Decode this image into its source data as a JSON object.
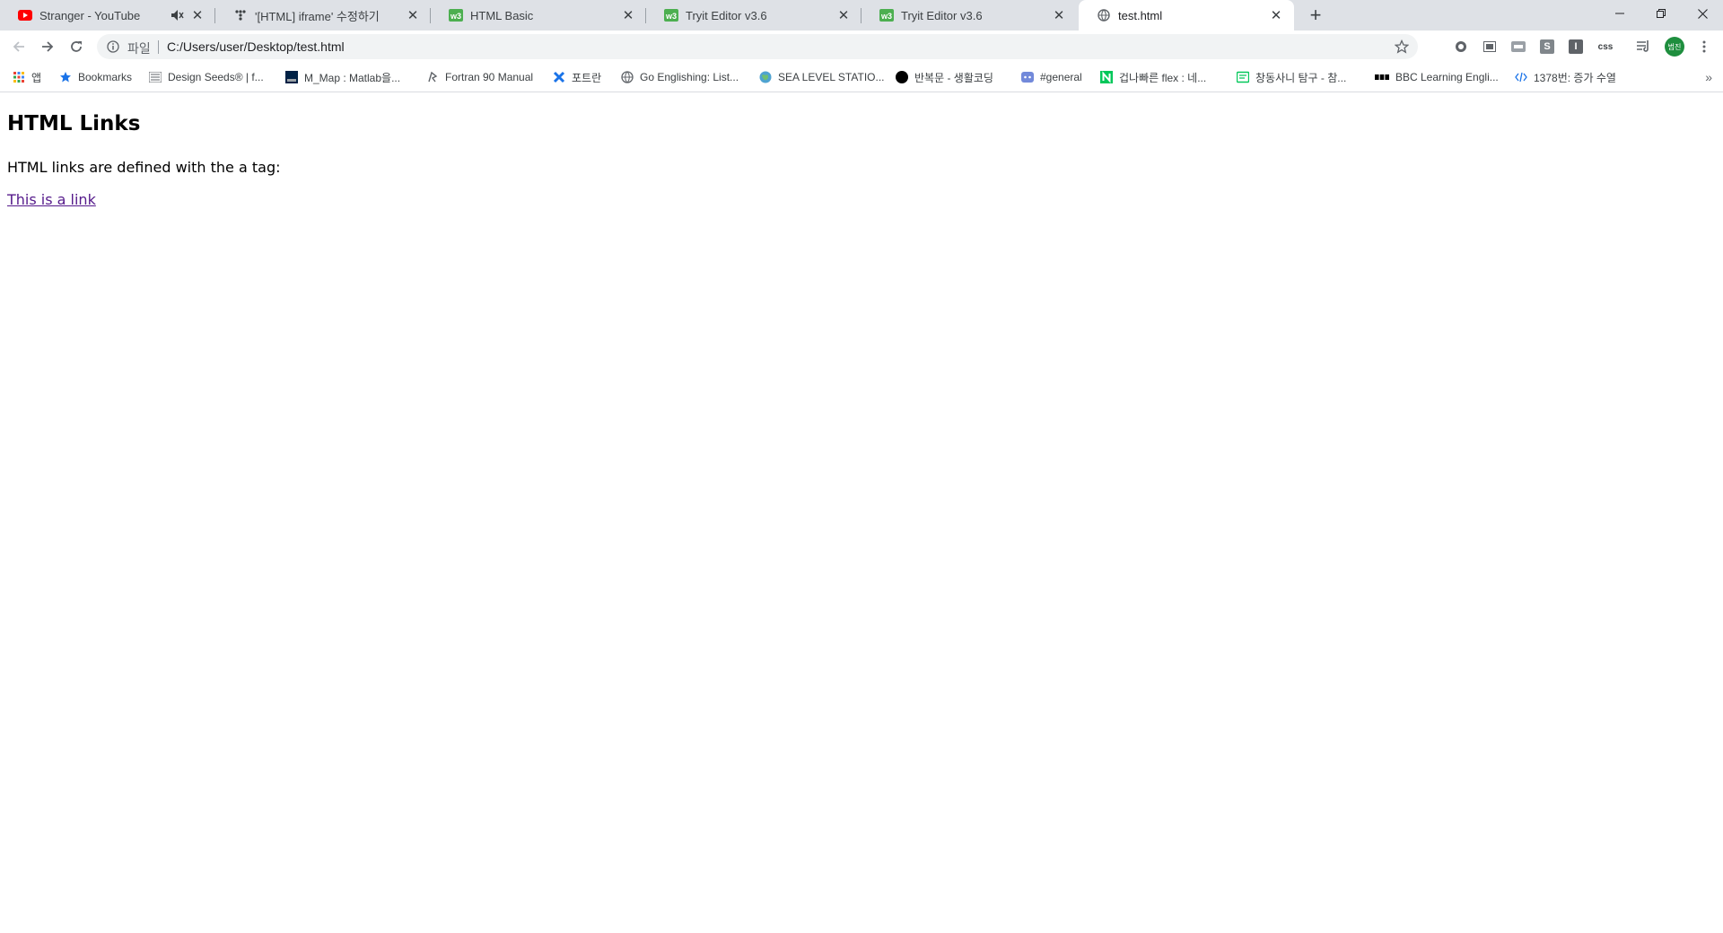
{
  "browser": {
    "tabs": [
      {
        "title": "Stranger - YouTube",
        "favicon": "youtube-icon",
        "muted": true
      },
      {
        "title": "'[HTML] iframe' 수정하기",
        "favicon": "tistory-icon"
      },
      {
        "title": "HTML Basic",
        "favicon": "w3schools-icon"
      },
      {
        "title": "Tryit Editor v3.6",
        "favicon": "w3schools-icon"
      },
      {
        "title": "Tryit Editor v3.6",
        "favicon": "w3schools-icon"
      },
      {
        "title": "test.html",
        "favicon": "globe-icon",
        "active": true
      }
    ],
    "omnibox": {
      "scheme_label": "파일",
      "url": "C:/Users/user/Desktop/test.html"
    },
    "extensions": {
      "css_label": "css",
      "s_label": "S",
      "i_label": "I",
      "avatar_label": "범진"
    },
    "bookmarks": [
      {
        "label": "앱",
        "icon": "apps-grid-icon"
      },
      {
        "label": "Bookmarks",
        "icon": "star-icon"
      },
      {
        "label": "Design Seeds® | f...",
        "icon": "design-seeds-icon"
      },
      {
        "label": "M_Map : Matlab을...",
        "icon": "ubc-icon"
      },
      {
        "label": "Fortran 90 Manual",
        "icon": "fortran-icon"
      },
      {
        "label": "포트란",
        "icon": "cross-icon"
      },
      {
        "label": "Go Englishing: List...",
        "icon": "globe-icon"
      },
      {
        "label": "SEA LEVEL STATIO...",
        "icon": "earth-icon"
      },
      {
        "label": "반복문 - 생활코딩",
        "icon": "black-circle-icon"
      },
      {
        "label": "#general",
        "icon": "discord-icon"
      },
      {
        "label": "겁나빠른 flex : 네...",
        "icon": "naver-icon"
      },
      {
        "label": "창동사니 탐구 - 참...",
        "icon": "blog-icon"
      },
      {
        "label": "BBC Learning Engli...",
        "icon": "bbc-icon"
      },
      {
        "label": "1378번: 증가 수열",
        "icon": "code-icon"
      }
    ],
    "colors": {
      "tabstrip": "#dee1e6",
      "link_visited": "#551a8b",
      "avatar": "#1e8e3e"
    }
  },
  "page": {
    "heading": "HTML Links",
    "description": "HTML links are defined with the a tag:",
    "link_text": "This is a link"
  }
}
